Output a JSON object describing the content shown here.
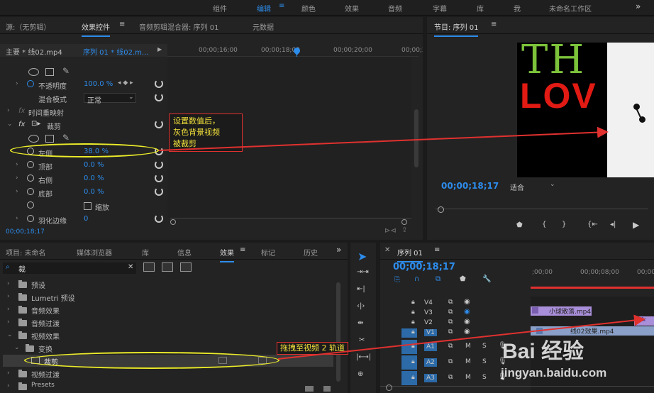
{
  "top_menu": {
    "items": [
      "组件",
      "编辑",
      "颜色",
      "效果",
      "音频",
      "字幕",
      "库",
      "我",
      "未命名工作区"
    ],
    "active": "编辑",
    "more": "»"
  },
  "effect_controls": {
    "tabs": [
      "源:（无剪辑）",
      "效果控件",
      "音频剪辑混合器: 序列 01",
      "元数据"
    ],
    "active_tab": "效果控件",
    "master": "主要 * 线02.mp4",
    "clip": "序列 01 * 线02.m...",
    "ruler": [
      "00;00;16;00",
      "00;00;18;00",
      "00;00;20;00",
      "00;00;2"
    ],
    "rows": {
      "opacity_label": "不透明度",
      "opacity_value": "100.0 %",
      "blend_label": "混合模式",
      "blend_value": "正常",
      "time_remap": "时间重映射",
      "crop_label": "裁剪",
      "left_label": "左侧",
      "left_value": "38.0 %",
      "top_label": "顶部",
      "top_value": "0.0 %",
      "right_label": "右侧",
      "right_value": "0.0 %",
      "bottom_label": "底部",
      "bottom_value": "0.0 %",
      "zoom_label": "缩放",
      "feather_label": "羽化边缘",
      "feather_value": "0"
    },
    "timecode": "00;00;18;17"
  },
  "program": {
    "title": "节目: 序列 01",
    "timecode": "00;00;18;17",
    "fit": "适合",
    "preview_text_top": "TH",
    "preview_text_bottom": "LOV"
  },
  "project": {
    "tabs": [
      "项目: 未命名",
      "媒体浏览器",
      "库",
      "信息",
      "效果",
      "标记",
      "历史"
    ],
    "active_tab": "效果",
    "search_value": "裁",
    "tree": [
      "预设",
      "Lumetri 预设",
      "音频效果",
      "音频过渡",
      "视频效果",
      "变换",
      "裁剪",
      "视频过渡",
      "Presets"
    ]
  },
  "timeline": {
    "title": "序列 01",
    "timecode": "00;00;18;17",
    "ruler": [
      ";00;00",
      "00;00;08;00",
      "00;00"
    ],
    "video_tracks": [
      "V4",
      "V3",
      "V2",
      "V1"
    ],
    "audio_tracks": [
      "A1",
      "A2",
      "A3"
    ],
    "track_buttons": {
      "mute": "M",
      "solo": "S"
    },
    "clip_v3": "小球散落.mp4",
    "clip_v1": "线02效果.mp4",
    "clip_v2_fx": "fx"
  },
  "annotations": {
    "note1": [
      "设置数值后，",
      "灰色背景视频",
      "被裁剪"
    ],
    "note2": "拖拽至视频 2 轨道"
  },
  "watermark": {
    "brand": "Bai 经验",
    "url": "jingyan.baidu.com"
  },
  "colors": {
    "accent": "#2d8ceb",
    "annotation_red": "#e0312f",
    "annotation_yellow": "#ecec2a",
    "clip_purple": "#a98fd9",
    "clip_blue": "#8aa0c8"
  }
}
